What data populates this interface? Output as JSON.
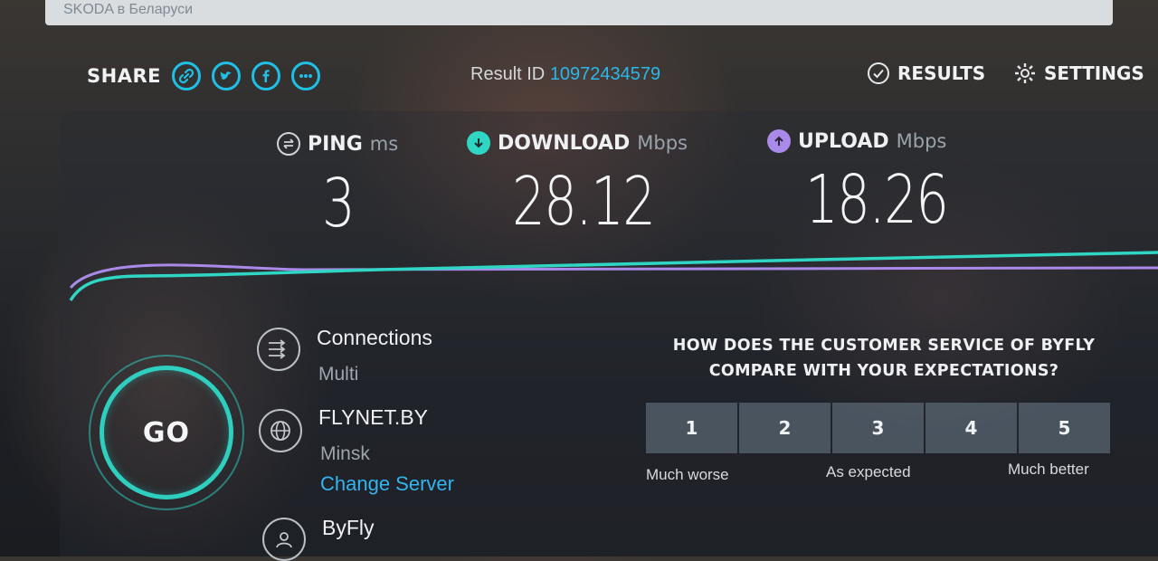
{
  "browser": {
    "tab_title": "SKODA в Беларуси"
  },
  "header": {
    "share_label": "SHARE",
    "share_icons": [
      "link-icon",
      "twitter-icon",
      "facebook-icon",
      "more-icon"
    ],
    "result_label": "Result ID",
    "result_id": "10972434579",
    "results_label": "RESULTS",
    "settings_label": "SETTINGS"
  },
  "metrics": {
    "ping": {
      "label": "PING",
      "unit": "ms",
      "value": "3"
    },
    "download": {
      "label": "DOWNLOAD",
      "unit": "Mbps",
      "value": "28.12"
    },
    "upload": {
      "label": "UPLOAD",
      "unit": "Mbps",
      "value": "18.26"
    }
  },
  "go": {
    "label": "GO"
  },
  "connections": {
    "title": "Connections",
    "value": "Multi"
  },
  "server": {
    "name": "FLYNET.BY",
    "location": "Minsk",
    "change_label": "Change Server"
  },
  "provider": {
    "name": "ByFly"
  },
  "survey": {
    "question": "HOW DOES THE CUSTOMER SERVICE OF BYFLY COMPARE WITH YOUR EXPECTATIONS?",
    "options": [
      "1",
      "2",
      "3",
      "4",
      "5"
    ],
    "low_label": "Much worse",
    "mid_label": "As expected",
    "high_label": "Much better"
  },
  "colors": {
    "accent": "#1fbfe6",
    "download_line": "#2fd6c4",
    "upload_line": "#a98ae8",
    "link": "#34b4ee"
  }
}
